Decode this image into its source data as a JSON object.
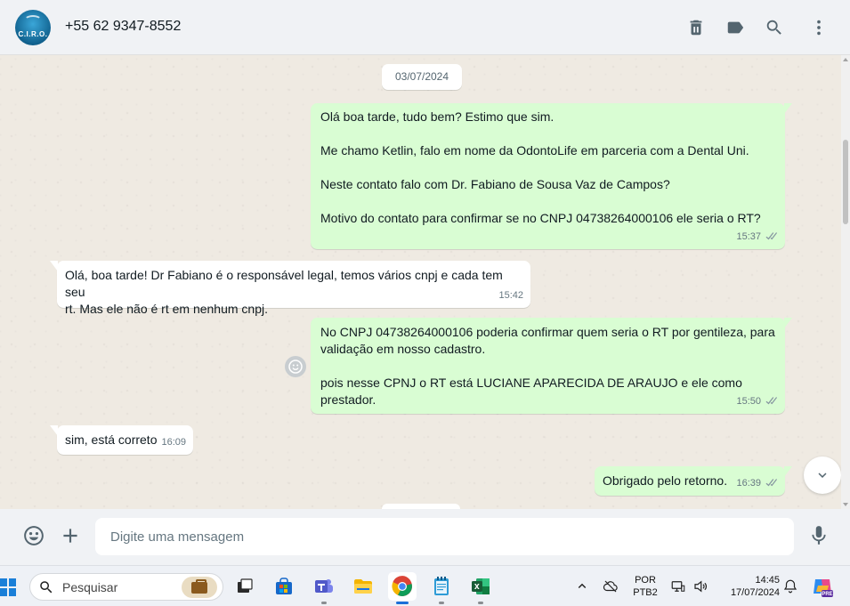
{
  "header": {
    "avatar_text": "C.I.R.O.",
    "contact": "+55 62 9347-8552",
    "icons": [
      "delete-icon",
      "label-icon",
      "search-icon",
      "menu-icon"
    ]
  },
  "chat": {
    "date_separator": "03/07/2024",
    "messages": [
      {
        "direction": "out",
        "text": "Olá boa tarde, tudo bem? Estimo que sim.\n\nMe chamo Ketlin, falo em nome da OdontoLife em parceria com a Dental Uni.\n\nNeste contato falo com Dr. Fabiano de Sousa Vaz de Campos?\n\nMotivo do contato para confirmar se no CNPJ 04738264000106 ele seria o RT?",
        "time": "15:37",
        "status": "read"
      },
      {
        "direction": "in",
        "text": "Olá, boa tarde! Dr Fabiano é o responsável legal, temos vários cnpj e cada tem seu\nrt. Mas ele não é rt em nenhum cnpj.",
        "time": "15:42"
      },
      {
        "direction": "out",
        "text": "No CNPJ 04738264000106 poderia confirmar quem seria o RT por gentileza, para\nvalidação em nosso cadastro.\n\npois nesse CPNJ o RT está LUCIANE APARECIDA DE ARAUJO e ele como prestador.",
        "time": "15:50",
        "status": "read"
      },
      {
        "direction": "in",
        "text": "sim, está correto",
        "time": "16:09"
      },
      {
        "direction": "out",
        "text": "Obrigado pelo retorno.",
        "time": "16:39",
        "status": "read"
      }
    ]
  },
  "composer": {
    "placeholder": "Digite uma mensagem",
    "icons": [
      "emoji-icon",
      "plus-icon",
      "mic-icon"
    ]
  },
  "taskbar": {
    "search_placeholder": "Pesquisar",
    "apps": [
      "task-view",
      "microsoft-store",
      "teams",
      "file-explorer",
      "chrome",
      "notepad",
      "excel"
    ],
    "active_app": "chrome",
    "language": "POR",
    "keyboard": "PTB2",
    "time": "14:45",
    "date": "17/07/2024"
  },
  "colors": {
    "outgoing_bubble": "#d9fdd3",
    "incoming_bubble": "#ffffff",
    "chat_background": "#efeae2",
    "header_background": "#f0f2f5",
    "read_tick": "#8696a0"
  }
}
